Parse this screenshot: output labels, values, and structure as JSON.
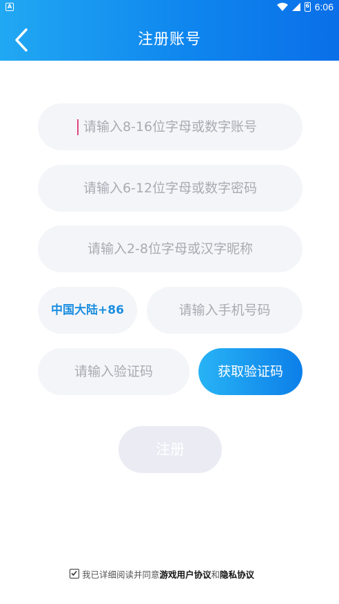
{
  "status_bar": {
    "app_badge": "A",
    "battery_badge": "6",
    "time": "6:06"
  },
  "header": {
    "title": "注册账号"
  },
  "form": {
    "account_placeholder": "请输入8-16位字母或数字账号",
    "password_placeholder": "请输入6-12位字母或数字密码",
    "nickname_placeholder": "请输入2-8位字母或汉字昵称",
    "region_label": "中国大陆+86",
    "phone_placeholder": "请输入手机号码",
    "code_placeholder": "请输入验证码",
    "get_code_label": "获取验证码",
    "register_label": "注册"
  },
  "agreement": {
    "checked": true,
    "prefix": "我已详细阅读并同意",
    "user_agreement": "游戏用户协议",
    "conjunction": "和",
    "privacy_agreement": "隐私协议"
  },
  "colors": {
    "header_start": "#21a8f3",
    "header_end": "#0a6fe8",
    "field_bg": "#f4f5f9",
    "placeholder": "#a9abb2",
    "region_text": "#1b8ee0",
    "register_disabled_bg": "#ebebf4"
  }
}
